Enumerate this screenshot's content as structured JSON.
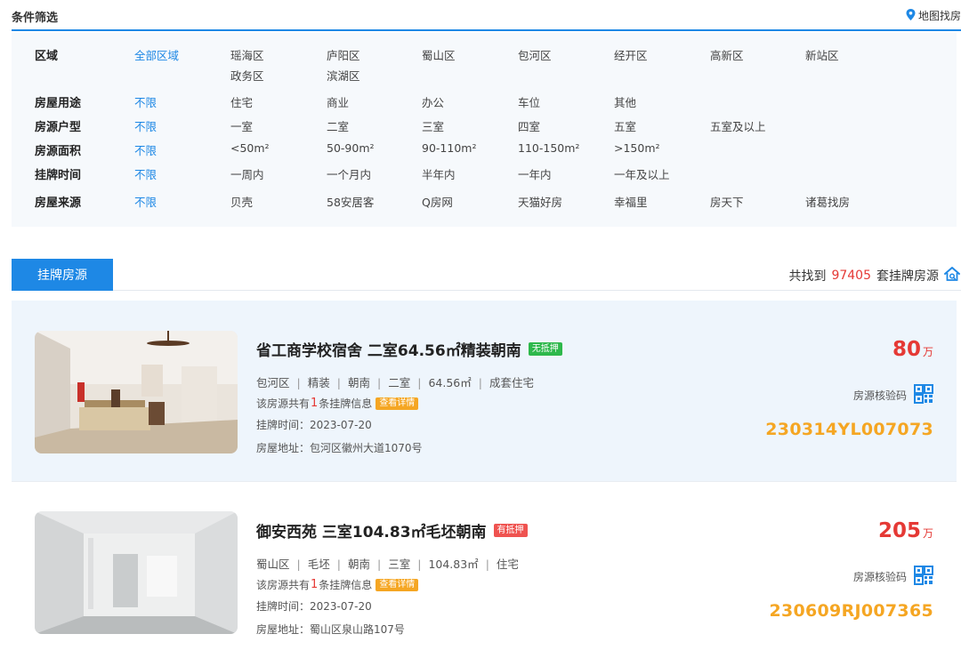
{
  "header": {
    "title": "条件筛选",
    "map_link": "地图找房",
    "map_icon": "location-pin-icon"
  },
  "filters": [
    {
      "label": "区域",
      "options": [
        "全部区域",
        "瑶海区",
        "庐阳区",
        "蜀山区",
        "包河区",
        "经开区",
        "高新区",
        "新站区",
        "政务区",
        "滨湖区"
      ],
      "active": 0
    },
    {
      "label": "房屋用途",
      "options": [
        "不限",
        "住宅",
        "商业",
        "办公",
        "车位",
        "其他"
      ],
      "active": 0
    },
    {
      "label": "房源户型",
      "options": [
        "不限",
        "一室",
        "二室",
        "三室",
        "四室",
        "五室",
        "五室及以上"
      ],
      "active": 0
    },
    {
      "label": "房源面积",
      "options": [
        "不限",
        "<50m²",
        "50-90m²",
        "90-110m²",
        "110-150m²",
        ">150m²"
      ],
      "active": 0
    },
    {
      "label": "挂牌时间",
      "options": [
        "不限",
        "一周内",
        "一个月内",
        "半年内",
        "一年内",
        "一年及以上"
      ],
      "active": 0
    },
    {
      "label": "房屋来源",
      "options": [
        "不限",
        "贝壳",
        "58安居客",
        "Q房网",
        "天猫好房",
        "幸福里",
        "房天下",
        "诸葛找房"
      ],
      "active": 0
    }
  ],
  "tabs": {
    "active_label": "挂牌房源",
    "count_prefix": "共找到",
    "count_value": "97405",
    "count_suffix": "套挂牌房源",
    "home_icon": "house-icon"
  },
  "listings": [
    {
      "title": "省工商学校宿舍 二室64.56㎡精装朝南",
      "badge": "无抵押",
      "badge_color": "#2eb84b",
      "attrs": [
        "包河区",
        "精装",
        "朝南",
        "二室",
        "64.56㎡",
        "成套住宅"
      ],
      "info_prefix": "该房源共有",
      "info_count": "1",
      "info_suffix": "条挂牌信息",
      "detail_label": "查看详情",
      "time": "挂牌时间：2023-07-20",
      "address": "房屋地址：包河区徽州大道1070号",
      "price": "80",
      "price_unit": "万",
      "verify_label": "房源核验码",
      "verify_code": "230314YL007073",
      "qr_icon": "qr-code-icon"
    },
    {
      "title": "御安西苑 三室104.83㎡毛坯朝南",
      "badge": "有抵押",
      "badge_color": "#ef5350",
      "attrs": [
        "蜀山区",
        "毛坯",
        "朝南",
        "三室",
        "104.83㎡",
        "住宅"
      ],
      "info_prefix": "该房源共有",
      "info_count": "1",
      "info_suffix": "条挂牌信息",
      "detail_label": "查看详情",
      "time": "挂牌时间：2023-07-20",
      "address": "房屋地址：蜀山区泉山路107号",
      "price": "205",
      "price_unit": "万",
      "verify_label": "房源核验码",
      "verify_code": "230609RJ007365",
      "qr_icon": "qr-code-icon"
    }
  ],
  "colors": {
    "accent": "#1e88e5",
    "price": "#e53935",
    "code": "#f5a623"
  }
}
